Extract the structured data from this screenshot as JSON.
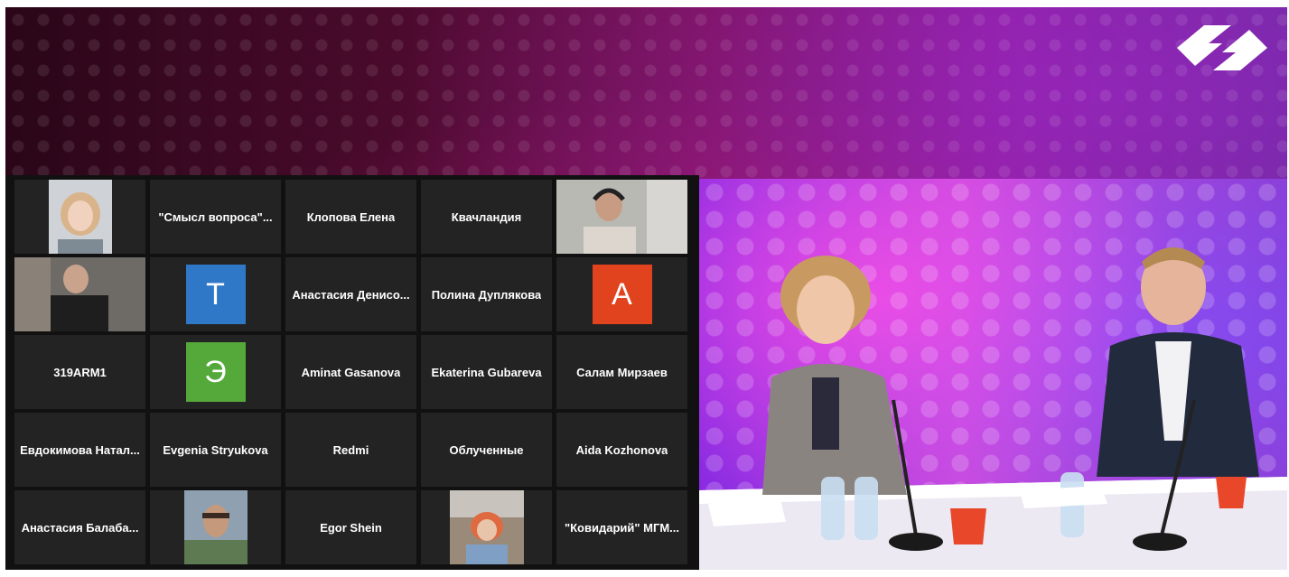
{
  "colors": {
    "tile_bg": "#232323",
    "active_border": "#b8d65a",
    "avatar_blue": "#2f78c8",
    "avatar_red": "#e0431e",
    "avatar_green": "#55a83a"
  },
  "participants": [
    {
      "name": "",
      "type": "video",
      "icon": "participant-video"
    },
    {
      "name": "\"Смысл вопроса\"..."
    },
    {
      "name": "Клопова Елена"
    },
    {
      "name": "Квачландия"
    },
    {
      "name": "",
      "type": "video",
      "icon": "participant-video"
    },
    {
      "name": "",
      "type": "video",
      "icon": "participant-video",
      "active": true
    },
    {
      "avatar": "T",
      "avatar_color": "#2f78c8"
    },
    {
      "name": "Анастасия Денисо..."
    },
    {
      "name": "Полина Дуплякова"
    },
    {
      "avatar": "A",
      "avatar_color": "#e0431e"
    },
    {
      "name": "319ARM1"
    },
    {
      "avatar": "Э",
      "avatar_color": "#55a83a"
    },
    {
      "name": "Aminat Gasanova"
    },
    {
      "name": "Ekaterina Gubareva"
    },
    {
      "name": "Салам Мирзаев"
    },
    {
      "name": "Евдокимова Натал..."
    },
    {
      "name": "Evgenia Stryukova"
    },
    {
      "name": "Redmi"
    },
    {
      "name": "Облученные"
    },
    {
      "name": "Aida Kozhonova"
    },
    {
      "name": "Анастасия Балаба..."
    },
    {
      "name": "",
      "type": "video",
      "icon": "participant-video"
    },
    {
      "name": "Egor Shein"
    },
    {
      "name": "",
      "type": "video",
      "icon": "participant-video"
    },
    {
      "name": "\"Ковидарий\" МГМ..."
    }
  ]
}
